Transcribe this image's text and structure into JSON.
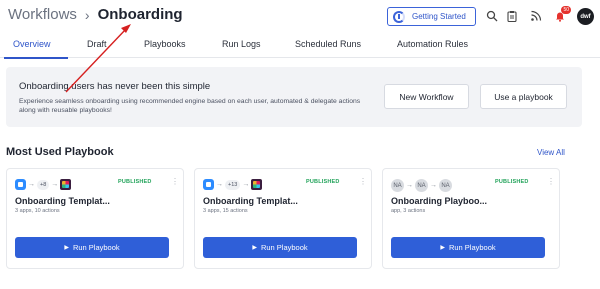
{
  "breadcrumb": {
    "parent": "Workflows",
    "separator": "›",
    "current": "Onboarding"
  },
  "header": {
    "getting_started": "Getting Started",
    "notification_count": "50",
    "avatar_initials": "dwf"
  },
  "tabs": [
    {
      "label": "Overview",
      "active": true
    },
    {
      "label": "Draft"
    },
    {
      "label": "Playbooks"
    },
    {
      "label": "Run Logs"
    },
    {
      "label": "Scheduled Runs"
    },
    {
      "label": "Automation Rules"
    }
  ],
  "banner": {
    "title": "Onboarding users has never been this simple",
    "description": "Experience seamless onboarding using recommended engine based on each user, automated & delegate actions along with reusable playbooks!",
    "new_workflow": "New Workflow",
    "use_playbook": "Use a playbook"
  },
  "section": {
    "title": "Most Used Playbook",
    "view_all": "View All"
  },
  "cards": [
    {
      "count": "+8",
      "status": "PUBLISHED",
      "title": "Onboarding Templat...",
      "subtitle": "3 apps, 10 actions",
      "button": "Run Playbook",
      "kebab": "⋮"
    },
    {
      "count": "+13",
      "status": "PUBLISHED",
      "title": "Onboarding Templat...",
      "subtitle": "3 apps, 15 actions",
      "button": "Run Playbook",
      "kebab": "⋮"
    },
    {
      "na1": "NA",
      "na2": "NA",
      "na3": "NA",
      "status": "PUBLISHED",
      "title": "Onboarding Playboo...",
      "subtitle": "app, 3 actions",
      "button": "Run Playbook",
      "kebab": "⋮"
    }
  ],
  "colors": {
    "accent": "#2f55c9",
    "published": "#22a35a",
    "annotation": "#d62020"
  }
}
